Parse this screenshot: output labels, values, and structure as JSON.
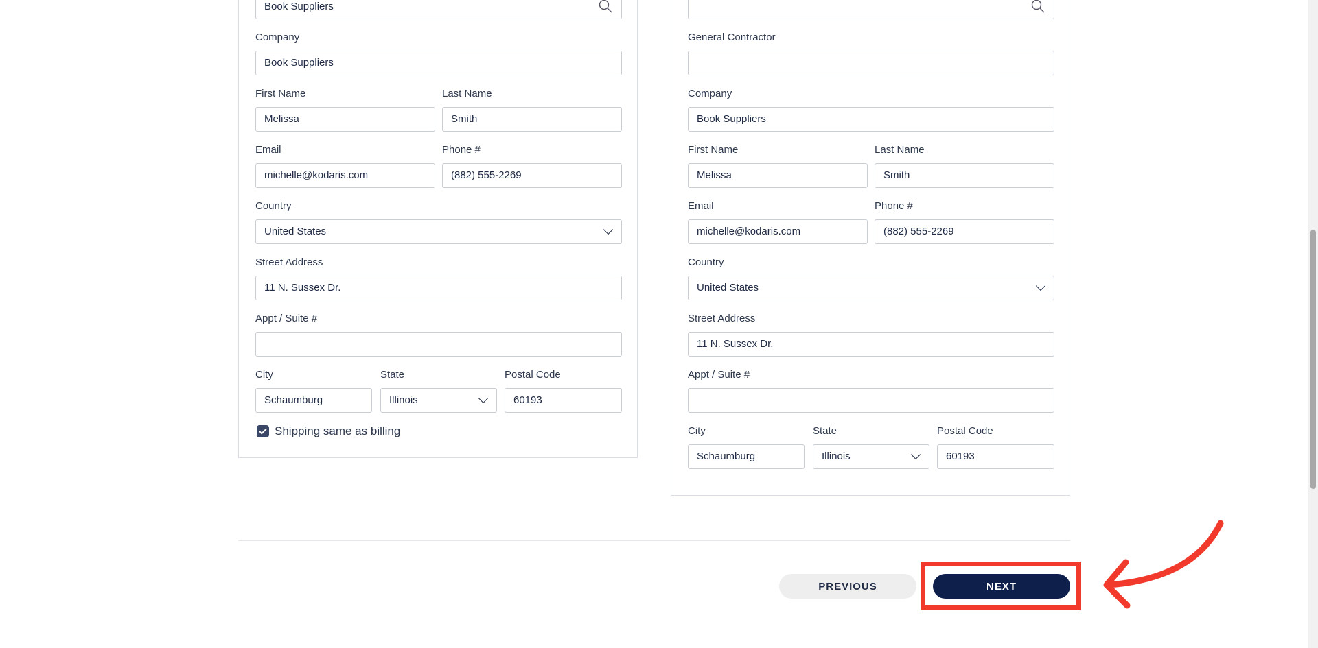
{
  "billing": {
    "search_value": "Book Suppliers",
    "company_label": "Company",
    "company_value": "Book Suppliers",
    "first_name_label": "First Name",
    "first_name_value": "Melissa",
    "last_name_label": "Last Name",
    "last_name_value": "Smith",
    "email_label": "Email",
    "email_value": "michelle@kodaris.com",
    "phone_label": "Phone #",
    "phone_value": "(882) 555-2269",
    "country_label": "Country",
    "country_value": "United States",
    "street_label": "Street Address",
    "street_value": "11 N. Sussex Dr.",
    "suite_label": "Appt / Suite #",
    "suite_value": "",
    "city_label": "City",
    "city_value": "Schaumburg",
    "state_label": "State",
    "state_value": "Illinois",
    "postal_label": "Postal Code",
    "postal_value": "60193",
    "same_as_billing_label": "Shipping same as billing"
  },
  "shipping": {
    "search_value": "",
    "contractor_label": "General Contractor",
    "contractor_value": "",
    "company_label": "Company",
    "company_value": "Book Suppliers",
    "first_name_label": "First Name",
    "first_name_value": "Melissa",
    "last_name_label": "Last Name",
    "last_name_value": "Smith",
    "email_label": "Email",
    "email_value": "michelle@kodaris.com",
    "phone_label": "Phone #",
    "phone_value": "(882) 555-2269",
    "country_label": "Country",
    "country_value": "United States",
    "street_label": "Street Address",
    "street_value": "11 N. Sussex Dr.",
    "suite_label": "Appt / Suite #",
    "suite_value": "",
    "city_label": "City",
    "city_value": "Schaumburg",
    "state_label": "State",
    "state_value": "Illinois",
    "postal_label": "Postal Code",
    "postal_value": "60193"
  },
  "nav": {
    "previous_label": "PREVIOUS",
    "next_label": "NEXT"
  },
  "icons": {
    "search": "search-icon",
    "chevron": "chevron-down-icon",
    "arrow": "curved-arrow-icon"
  },
  "colors": {
    "primary": "#0f1f4b",
    "annotation": "#f13a2b",
    "checkbox": "#3b4766"
  }
}
